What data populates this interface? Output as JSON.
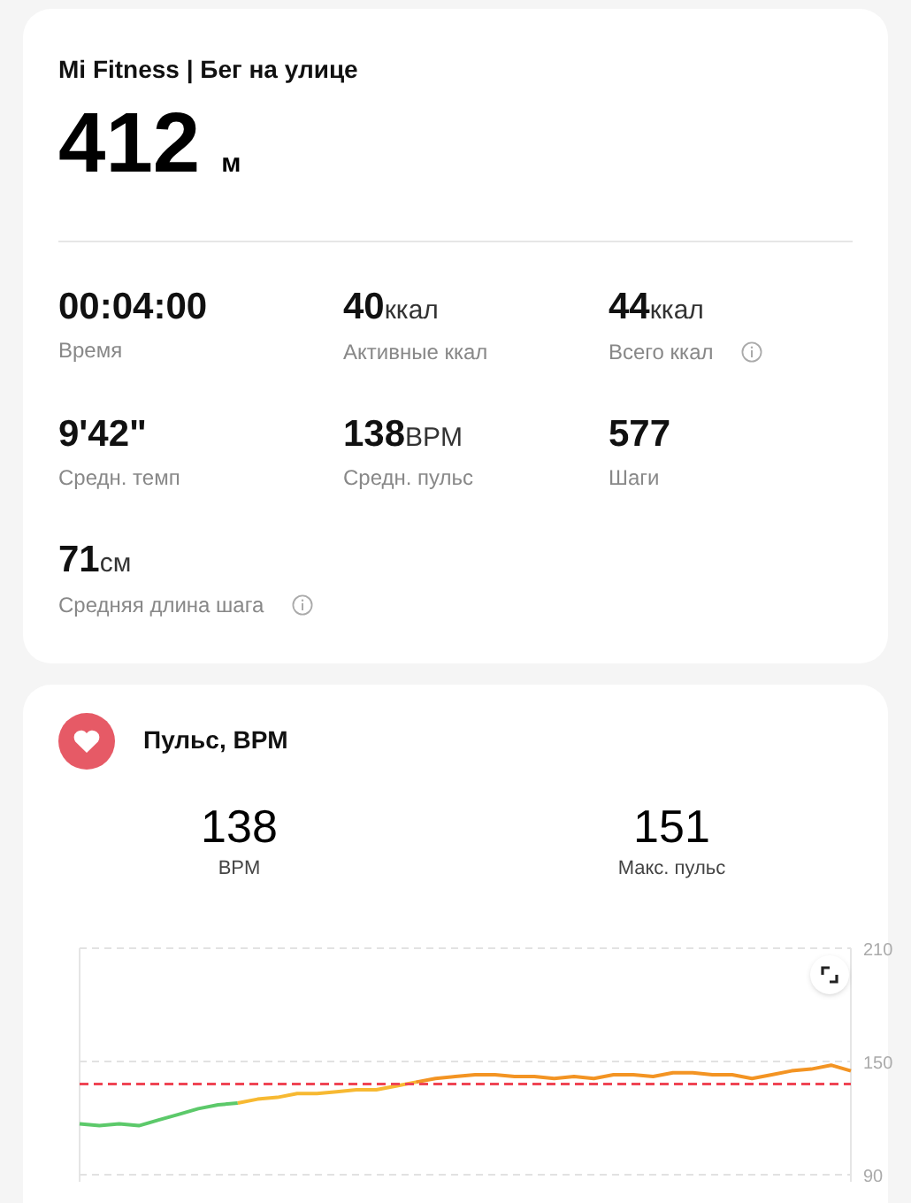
{
  "summary": {
    "title": "Mi Fitness | Бег на улице",
    "distance": "412",
    "distance_unit": "м",
    "stats": [
      {
        "value": "00:04:00",
        "label": "Время",
        "info": false
      },
      {
        "value": "40",
        "unit": "ккал",
        "label": "Активные ккал",
        "info": false
      },
      {
        "value": "44",
        "unit": "ккал",
        "label": "Всего ккал",
        "info": true
      },
      {
        "value": "9'42\"",
        "label": "Средн. темп",
        "info": false
      },
      {
        "value": "138",
        "unit": "BPM",
        "label": "Средн. пульс",
        "info": false
      },
      {
        "value": "577",
        "label": "Шаги",
        "info": false
      },
      {
        "value": "71",
        "unit": "см",
        "label": "Средняя длина шага",
        "info": true
      }
    ]
  },
  "heart_rate": {
    "title": "Пульс, BPM",
    "figures": [
      {
        "value": "138",
        "label": "BPM"
      },
      {
        "value": "151",
        "label": "Макс. пульс"
      }
    ],
    "chart_data": {
      "type": "line",
      "ylim": [
        90,
        210
      ],
      "yticks": [
        90,
        150,
        210
      ],
      "series": [
        {
          "color": "#5cc96a",
          "values": [
            117,
            116,
            117,
            116,
            119,
            122,
            125,
            127,
            128,
            null,
            null,
            null,
            null,
            null,
            null,
            null,
            null,
            null,
            null,
            null,
            null,
            null,
            null,
            null,
            null,
            null,
            null,
            null,
            null,
            null,
            null,
            null,
            null,
            null,
            null,
            null,
            null,
            null,
            null,
            null
          ]
        },
        {
          "color": "#f7b932",
          "values": [
            null,
            null,
            null,
            null,
            null,
            null,
            null,
            null,
            128,
            130,
            131,
            133,
            133,
            134,
            135,
            135,
            137,
            139,
            null,
            null,
            null,
            null,
            null,
            null,
            null,
            null,
            null,
            null,
            null,
            null,
            null,
            null,
            null,
            null,
            null,
            null,
            null,
            null,
            null,
            null
          ]
        },
        {
          "color": "#f39423",
          "values": [
            null,
            null,
            null,
            null,
            null,
            null,
            null,
            null,
            null,
            null,
            null,
            null,
            null,
            null,
            null,
            null,
            null,
            139,
            141,
            142,
            143,
            143,
            142,
            142,
            141,
            142,
            141,
            143,
            143,
            142,
            144,
            144,
            143,
            143,
            141,
            143,
            145,
            146,
            148,
            145
          ]
        },
        {
          "color": "#ef4453",
          "line_style": "dashed",
          "values": [
            138,
            138,
            138,
            138,
            138,
            138,
            138,
            138,
            138,
            138,
            138,
            138,
            138,
            138,
            138,
            138,
            138,
            138,
            138,
            138,
            138,
            138,
            138,
            138,
            138,
            138,
            138,
            138,
            138,
            138,
            138,
            138,
            138,
            138,
            138,
            138,
            138,
            138,
            138,
            138
          ]
        }
      ]
    }
  }
}
